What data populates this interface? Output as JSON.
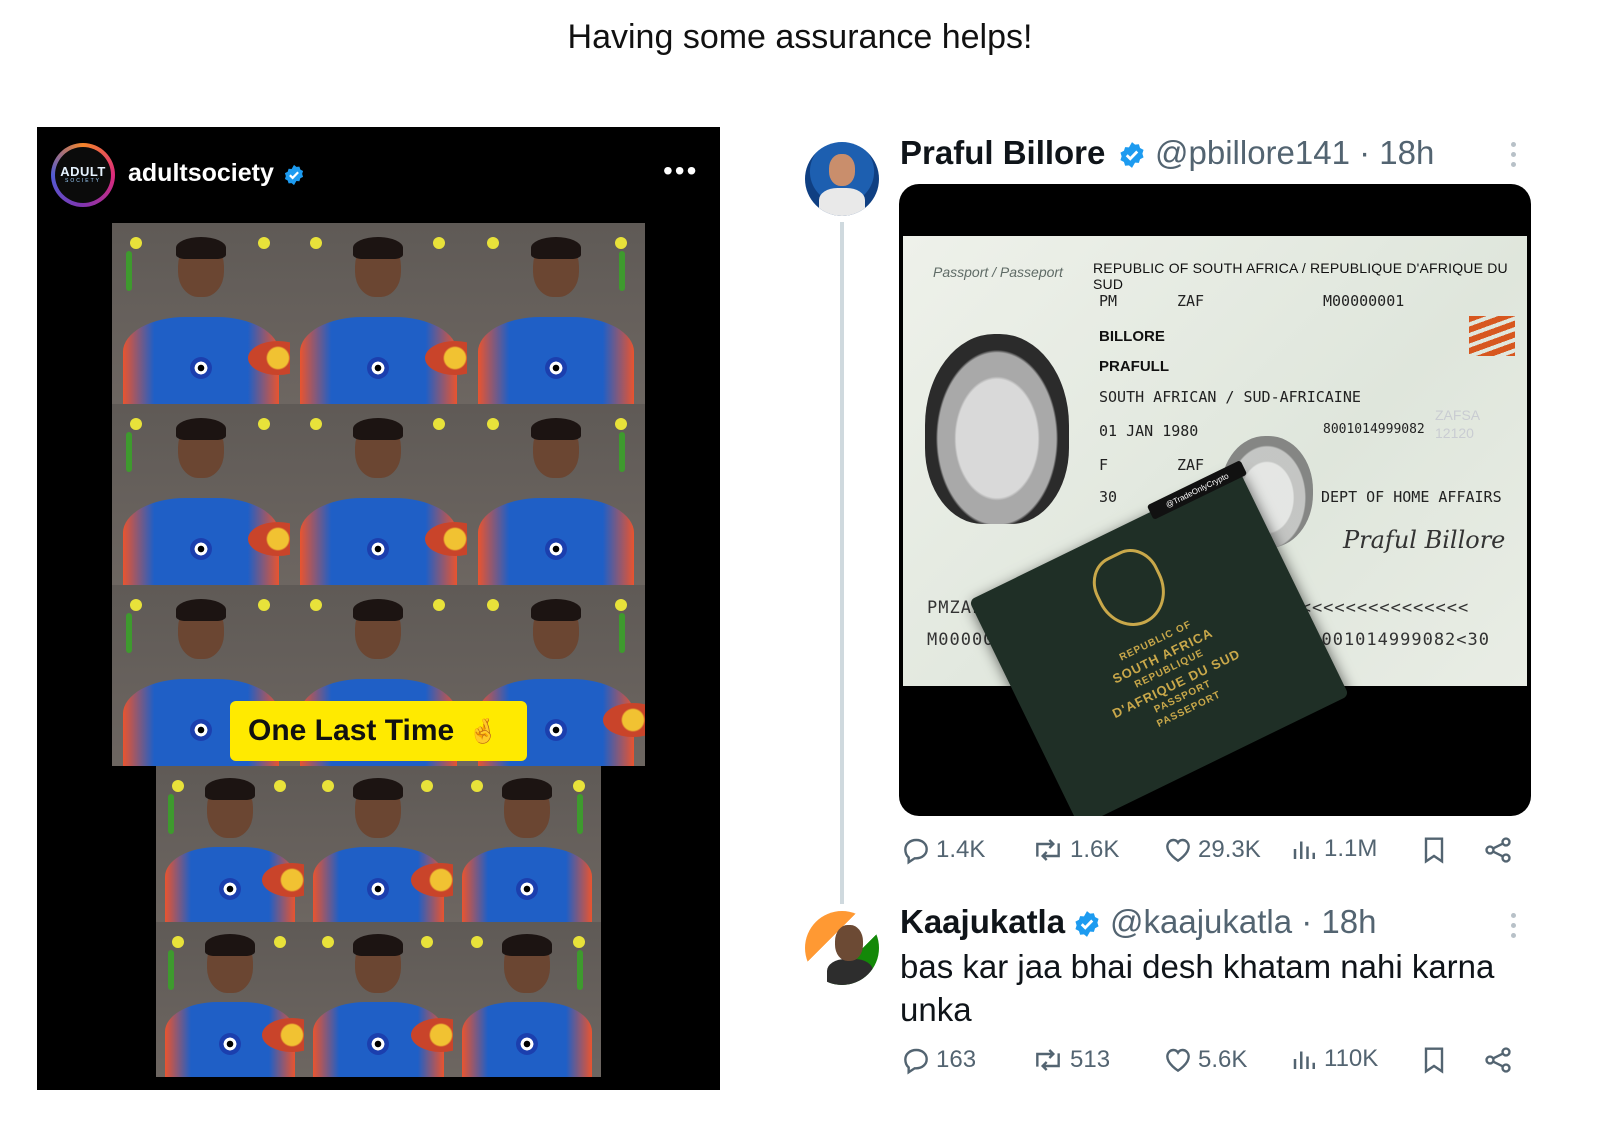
{
  "caption": "Having some assurance helps!",
  "instagram": {
    "username": "adultsociety",
    "avatar_logo": "ADULT",
    "avatar_logo_sub": "SOCIETY",
    "more_icon": "more-horizontal-icon",
    "overlay_text": "One Last Time",
    "overlay_emoji": "🤞"
  },
  "tweet1": {
    "name": "Praful Billore",
    "handle": "@pbillore141 · 18h",
    "passport": {
      "tag": "Passport / Passeport",
      "country": "REPUBLIC OF SOUTH AFRICA / REPUBLIQUE D'AFRIQUE DU SUD",
      "type": "PM",
      "code": "ZAF",
      "number": "M00000001",
      "surname": "BILLORE",
      "given_names": "PRAFULL",
      "nationality": "SOUTH AFRICAN / SUD-AFRICAINE",
      "dob": "01 JAN 1980",
      "id_number": "8001014999082",
      "sex": "F",
      "place_of_birth": "ZAF",
      "issue_partial": "30",
      "authority": "DEPT OF HOME AFFAIRS",
      "signature": "Praful Billore",
      "zafsa": "ZAFSA",
      "zafsa_num": "12120",
      "mrz1_left": "PMZAFS",
      "mrz1_right": "<<<<<<<<<<<<<<<<<<",
      "mrz2_left": "M0000000",
      "mrz2_right": "08001014999082<30",
      "watermark": "@TradeOnlyCrypto",
      "booklet_l1": "REPUBLIC OF",
      "booklet_l2": "SOUTH AFRICA",
      "booklet_l3": "REPUBLIQUE",
      "booklet_l4": "D'AFRIQUE DU SUD",
      "booklet_l5": "PASSPORT",
      "booklet_l6": "PASSEPORT"
    },
    "stats": {
      "replies": "1.4K",
      "reposts": "1.6K",
      "likes": "29.3K",
      "views": "1.1M"
    }
  },
  "tweet2": {
    "name": "Kaajukatla",
    "handle": "@kaajukatla · 18h",
    "text": "bas kar jaa bhai desh khatam nahi karna unka",
    "stats": {
      "replies": "163",
      "reposts": "513",
      "likes": "5.6K",
      "views": "110K"
    }
  },
  "colors": {
    "verified": "#1d9bf0",
    "overlay": "#ffea00",
    "muted": "#536471"
  }
}
